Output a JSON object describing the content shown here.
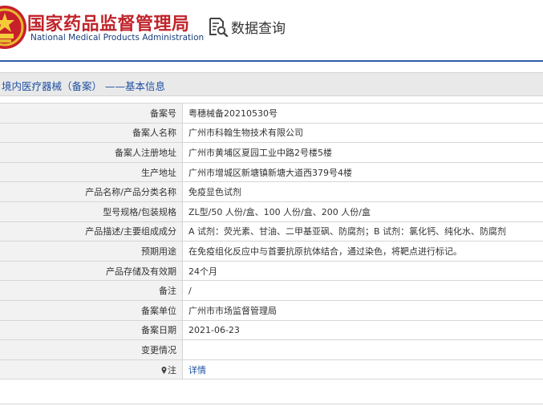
{
  "header": {
    "brand_cn": "国家药品监督管理局",
    "brand_en": "National Medical Products Administration",
    "query_title": "数据查询",
    "accent_red": "#c0242b",
    "accent_blue": "#2c5ea8"
  },
  "section": {
    "title": "境内医疗器械（备案） ——基本信息"
  },
  "rows": [
    {
      "label": "备案号",
      "value": "粤穗械备20210530号"
    },
    {
      "label": "备案人名称",
      "value": "广州市科翰生物技术有限公司"
    },
    {
      "label": "备案人注册地址",
      "value": "广州市黄埔区夏园工业中路2号楼5楼"
    },
    {
      "label": "生产地址",
      "value": "广州市增城区新塘镇新塘大道西379号4楼"
    },
    {
      "label": "产品名称/产品分类名称",
      "value": "免疫显色试剂"
    },
    {
      "label": "型号规格/包装规格",
      "value": "ZL型/50 人份/盒、100 人份/盒、200 人份/盒"
    },
    {
      "label": "产品描述/主要组成成分",
      "value": "A 试剂：荧光素、甘油、二甲基亚砜、防腐剂；B 试剂：氯化钙、纯化水、防腐剂"
    },
    {
      "label": "预期用途",
      "value": "在免疫组化反应中与首要抗原抗体结合，通过染色，将靶点进行标记。"
    },
    {
      "label": "产品存储及有效期",
      "value": "24个月"
    },
    {
      "label": "备注",
      "value": "/"
    },
    {
      "label": "备案单位",
      "value": "广州市市场监督管理局"
    },
    {
      "label": "备案日期",
      "value": "2021-06-23"
    },
    {
      "label": "变更情况",
      "value": ""
    },
    {
      "label": "注",
      "value": "详情"
    }
  ]
}
